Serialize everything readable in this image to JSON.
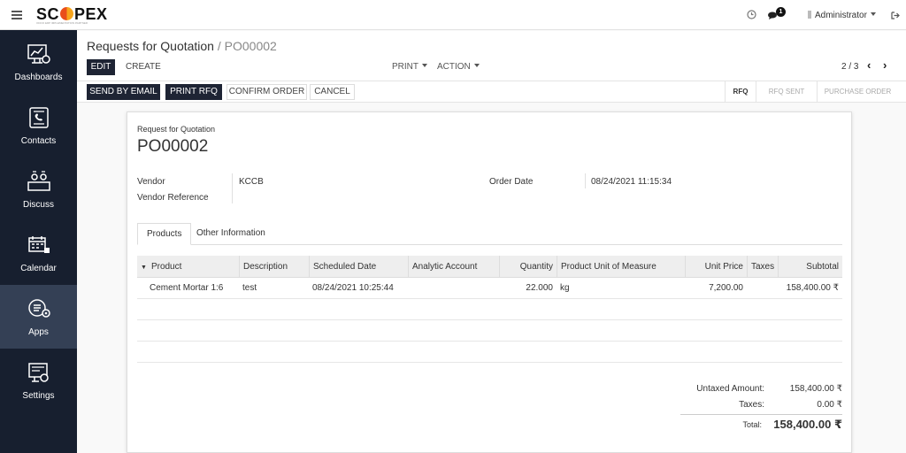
{
  "topbar": {
    "logo_pre": "SC",
    "logo_post": "PEX",
    "logo_tagline": "ODOO ERP IMPLEMENTATION PARTNER",
    "chat_count": "1",
    "user": "Administrator",
    "icons": [
      "menu-icon",
      "clock-icon",
      "chat-icon",
      "user-avatar-icon",
      "logout-icon"
    ]
  },
  "sidebar": {
    "active": "Apps",
    "items": [
      {
        "label": "Dashboards",
        "icon": "dashboard-icon"
      },
      {
        "label": "Contacts",
        "icon": "contacts-icon"
      },
      {
        "label": "Discuss",
        "icon": "discuss-icon"
      },
      {
        "label": "Calendar",
        "icon": "calendar-icon"
      },
      {
        "label": "Apps",
        "icon": "apps-icon"
      },
      {
        "label": "Settings",
        "icon": "settings-icon"
      }
    ]
  },
  "breadcrumb": {
    "parent": "Requests for Quotation",
    "separator": "/",
    "current": "PO00002"
  },
  "actions": {
    "edit": "EDIT",
    "create": "CREATE",
    "print": "PRINT",
    "action": "ACTION"
  },
  "pager": {
    "value": "2 / 3"
  },
  "statusbar": {
    "buttons": [
      "SEND BY EMAIL",
      "PRINT RFQ",
      "CONFIRM ORDER",
      "CANCEL"
    ],
    "stages": [
      {
        "label": "RFQ",
        "active": true
      },
      {
        "label": "RFQ SENT",
        "active": false
      },
      {
        "label": "PURCHASE ORDER",
        "active": false
      }
    ]
  },
  "form": {
    "subtitle": "Request for Quotation",
    "name": "PO00002",
    "vendor_label": "Vendor",
    "vendor_value": "KCCB",
    "vendor_ref_label": "Vendor Reference",
    "vendor_ref_value": "",
    "order_date_label": "Order Date",
    "order_date_value": "08/24/2021 11:15:34"
  },
  "tabs": [
    "Products",
    "Other Information"
  ],
  "table": {
    "columns": [
      "Product",
      "Description",
      "Scheduled Date",
      "Analytic Account",
      "Quantity",
      "Product Unit of Measure",
      "Unit Price",
      "Taxes",
      "Subtotal"
    ],
    "rows": [
      {
        "product": "Cement Mortar 1:6",
        "description": "test",
        "scheduled_date": "08/24/2021 10:25:44",
        "analytic_account": "",
        "quantity": "22.000",
        "uom": "kg",
        "unit_price": "7,200.00",
        "taxes": "",
        "subtotal": "158,400.00 ₹"
      }
    ]
  },
  "totals": {
    "untaxed_label": "Untaxed Amount:",
    "untaxed_value": "158,400.00 ₹",
    "taxes_label": "Taxes:",
    "taxes_value": "0.00 ₹",
    "total_label": "Total:",
    "total_value": "158,400.00 ₹"
  }
}
